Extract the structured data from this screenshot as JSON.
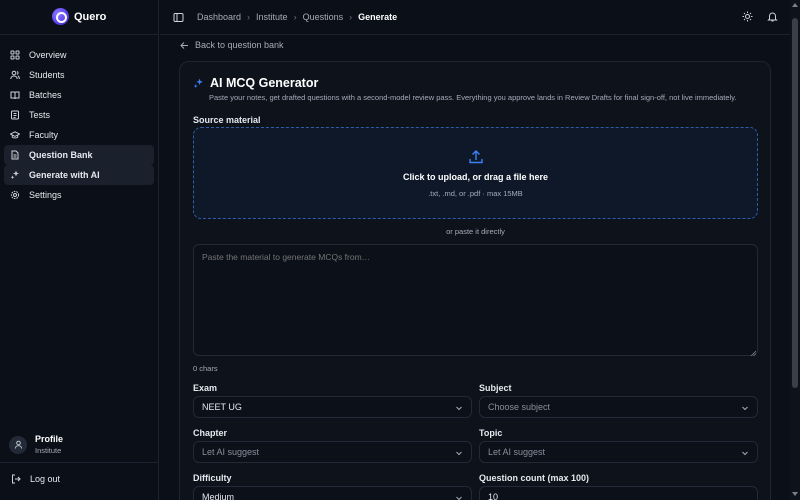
{
  "brand": {
    "name": "Quero"
  },
  "sidebar": {
    "items": [
      {
        "label": "Overview",
        "icon": "grid-icon"
      },
      {
        "label": "Students",
        "icon": "users-icon"
      },
      {
        "label": "Batches",
        "icon": "book-icon"
      },
      {
        "label": "Tests",
        "icon": "list-icon"
      },
      {
        "label": "Faculty",
        "icon": "graduation-cap-icon"
      },
      {
        "label": "Question Bank",
        "icon": "file-text-icon"
      },
      {
        "label": "Generate with AI",
        "icon": "sparkles-icon"
      },
      {
        "label": "Settings",
        "icon": "gear-icon"
      }
    ],
    "profile": {
      "name": "Profile",
      "role": "Institute"
    },
    "logout_label": "Log out"
  },
  "header": {
    "breadcrumb": [
      "Dashboard",
      "Institute",
      "Questions",
      "Generate"
    ]
  },
  "main": {
    "back_label": "Back to question bank",
    "title": "AI MCQ Generator",
    "subtitle": "Paste your notes, get drafted questions with a second-model review pass. Everything you approve lands in Review Drafts for final sign-off, not live immediately.",
    "source_label": "Source material",
    "upload_title": "Click to upload, or drag a file here",
    "upload_hint": ".txt, .md, or .pdf · max 15MB",
    "or_paste": "or paste it directly",
    "textarea_placeholder": "Paste the material to generate MCQs from…",
    "char_count": "0 chars",
    "fields": {
      "exam": {
        "label": "Exam",
        "value": "NEET UG"
      },
      "subject": {
        "label": "Subject",
        "value": "Choose subject"
      },
      "chapter": {
        "label": "Chapter",
        "value": "Let AI suggest"
      },
      "topic": {
        "label": "Topic",
        "value": "Let AI suggest"
      },
      "difficulty": {
        "label": "Difficulty",
        "value": "Medium"
      },
      "count": {
        "label": "Question count (max 100)",
        "value": "10"
      }
    }
  },
  "colors": {
    "accent": "#3b82f6",
    "brand": "#6a4ff5",
    "background": "#0b0f17"
  }
}
